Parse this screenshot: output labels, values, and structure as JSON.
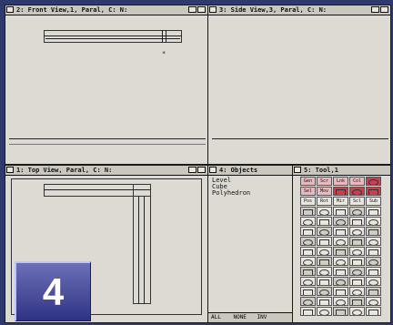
{
  "windows": {
    "front": {
      "title": "2: Front View,1, Paral, C: N:"
    },
    "side": {
      "title": "3: Side View,3, Paral, C: N:"
    },
    "top": {
      "title": "1: Top View, Paral, C: N:"
    },
    "objects": {
      "title": "4: Objects",
      "items": [
        "Level",
        "Cube",
        "Polyhedron"
      ],
      "footer": [
        "ALL",
        "NONE",
        "INV"
      ]
    },
    "tools": {
      "title": "5: Tool,1",
      "rows": [
        [
          "Gen",
          "Scr",
          "Lnk",
          "Col",
          ""
        ],
        [
          "Sel",
          "Mov",
          "",
          "",
          ""
        ],
        [
          "Pos",
          "Rot",
          "Mir",
          "Scl",
          "Sub"
        ]
      ]
    }
  },
  "badge": {
    "number": "4"
  },
  "colors": {
    "accent_red": "#c84050",
    "badge_top": "#6c70b8",
    "badge_bottom": "#2f3384",
    "window_bg": "#dcdad2"
  }
}
